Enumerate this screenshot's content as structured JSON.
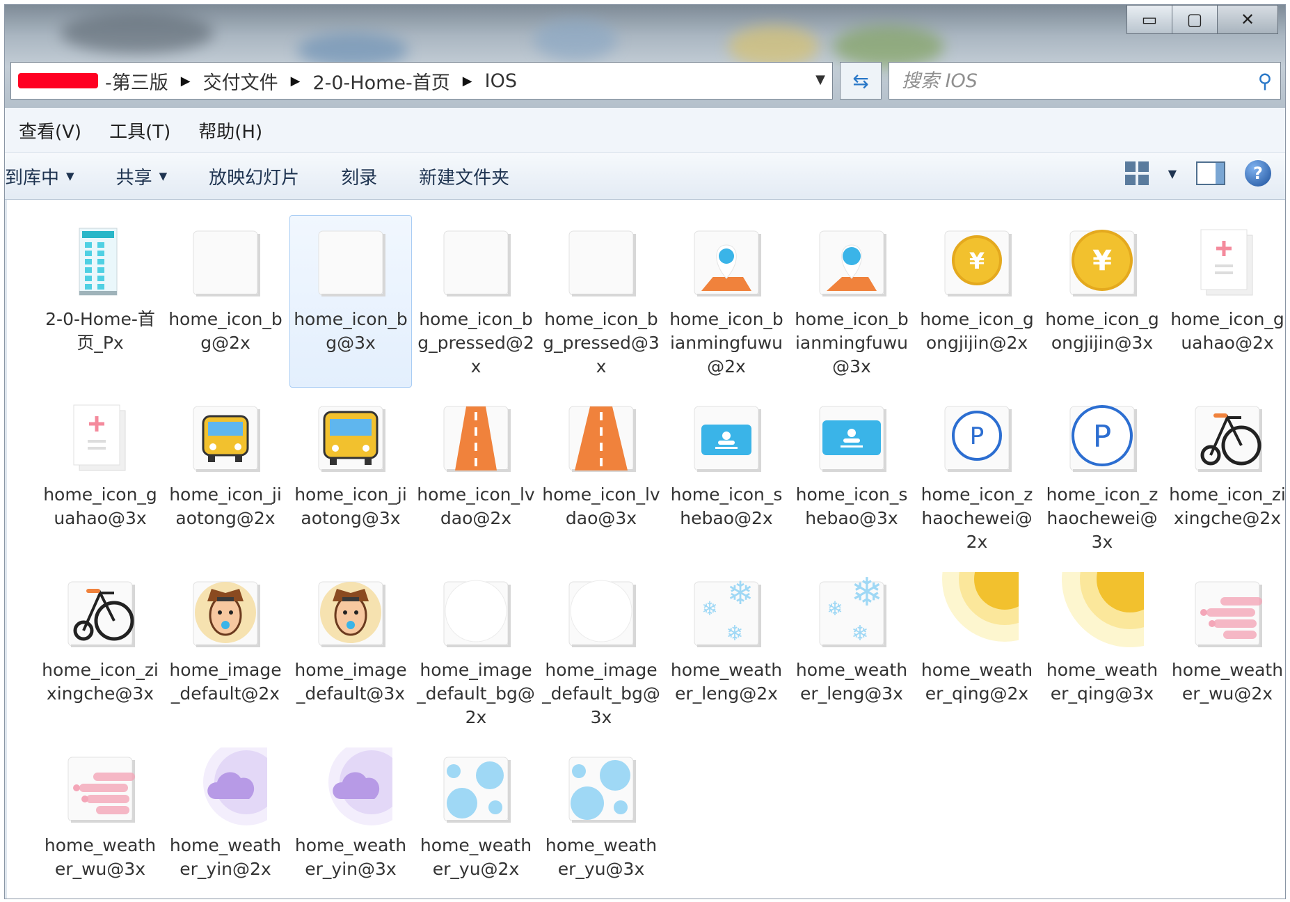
{
  "window": {
    "caption_buttons": {
      "minimize": "▭",
      "maximize": "▢",
      "close": "✕"
    }
  },
  "address_bar": {
    "crumbs": [
      "-第三版",
      "交付文件",
      "2-0-Home-首页",
      "IOS"
    ],
    "dropdown_glyph": "▼"
  },
  "search": {
    "placeholder": "搜索 IOS"
  },
  "menu": {
    "items": [
      "查看(V)",
      "工具(T)",
      "帮助(H)"
    ]
  },
  "commands": {
    "library": "到库中",
    "share": "共享",
    "slideshow": "放映幻灯片",
    "burn": "刻录",
    "new_folder": "新建文件夹",
    "help_glyph": "?"
  },
  "files": [
    {
      "name": "2-0-Home-首页_Px",
      "icon": "phone-mockup-icon"
    },
    {
      "name": "home_icon_bg@2x",
      "icon": "blank-tile-icon"
    },
    {
      "name": "home_icon_bg@3x",
      "icon": "blank-tile-icon"
    },
    {
      "name": "home_icon_bg_pressed@2x",
      "icon": "blank-tile-icon"
    },
    {
      "name": "home_icon_bg_pressed@3x",
      "icon": "blank-tile-icon"
    },
    {
      "name": "home_icon_bianmingfuwu@2x",
      "icon": "location-pin-icon"
    },
    {
      "name": "home_icon_bianmingfuwu@3x",
      "icon": "location-pin-icon"
    },
    {
      "name": "home_icon_gongjijin@2x",
      "icon": "yen-coin-icon"
    },
    {
      "name": "home_icon_gongjijin@3x",
      "icon": "yen-coin-icon"
    },
    {
      "name": "home_icon_guahao@2x",
      "icon": "medical-card-icon"
    },
    {
      "name": "home_icon_guahao@3x",
      "icon": "medical-card-icon"
    },
    {
      "name": "home_icon_jiaotong@2x",
      "icon": "bus-icon"
    },
    {
      "name": "home_icon_jiaotong@3x",
      "icon": "bus-icon"
    },
    {
      "name": "home_icon_lvdao@2x",
      "icon": "road-icon"
    },
    {
      "name": "home_icon_lvdao@3x",
      "icon": "road-icon"
    },
    {
      "name": "home_icon_shebao@2x",
      "icon": "id-card-icon"
    },
    {
      "name": "home_icon_shebao@3x",
      "icon": "id-card-icon"
    },
    {
      "name": "home_icon_zhaochewei@2x",
      "icon": "parking-icon"
    },
    {
      "name": "home_icon_zhaochewei@3x",
      "icon": "parking-icon"
    },
    {
      "name": "home_icon_zixingche@2x",
      "icon": "bicycle-icon"
    },
    {
      "name": "home_icon_zixingche@3x",
      "icon": "bicycle-icon"
    },
    {
      "name": "home_image_default@2x",
      "icon": "avatar-icon"
    },
    {
      "name": "home_image_default@3x",
      "icon": "avatar-icon"
    },
    {
      "name": "home_image_default_bg@2x",
      "icon": "white-circle-icon"
    },
    {
      "name": "home_image_default_bg@3x",
      "icon": "white-circle-icon"
    },
    {
      "name": "home_weather_leng@2x",
      "icon": "snowflake-icon"
    },
    {
      "name": "home_weather_leng@3x",
      "icon": "snowflake-icon"
    },
    {
      "name": "home_weather_qing@2x",
      "icon": "sun-icon"
    },
    {
      "name": "home_weather_qing@3x",
      "icon": "sun-icon"
    },
    {
      "name": "home_weather_wu@2x",
      "icon": "fog-icon"
    },
    {
      "name": "home_weather_wu@3x",
      "icon": "fog-icon"
    },
    {
      "name": "home_weather_yin@2x",
      "icon": "cloud-icon"
    },
    {
      "name": "home_weather_yin@3x",
      "icon": "cloud-icon"
    },
    {
      "name": "home_weather_yu@2x",
      "icon": "rain-icon"
    },
    {
      "name": "home_weather_yu@3x",
      "icon": "rain-icon"
    }
  ],
  "selected_file": "home_icon_bg@3x",
  "colors": {
    "orange": "#f0823c",
    "blue": "#3ab4e8",
    "yellow": "#f2c12e",
    "purple": "#b79ae6",
    "pink": "#f4a6b8",
    "light_blue": "#9fd8f5"
  }
}
